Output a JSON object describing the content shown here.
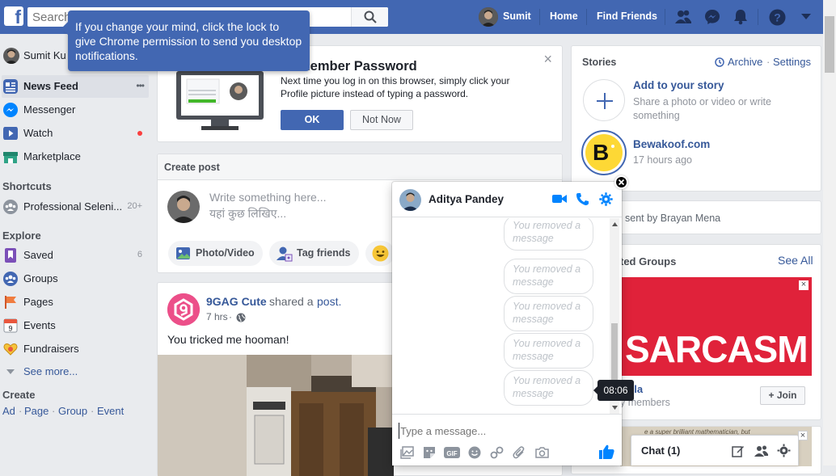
{
  "header": {
    "logo": "f",
    "search_placeholder": "Search",
    "user_name": "Sumit",
    "home_label": "Home",
    "find_friends_label": "Find Friends",
    "brand_color": "#4267b2"
  },
  "notification_tip": {
    "text": "If you change your mind, click the lock to give Chrome permission to send you desktop notifications."
  },
  "left_nav": {
    "profile_name": "Sumit Ku",
    "items": [
      {
        "label": "News Feed",
        "icon": "news-feed-icon",
        "more": "•••"
      },
      {
        "label": "Messenger",
        "icon": "messenger-icon"
      },
      {
        "label": "Watch",
        "icon": "watch-icon",
        "dot_color": "#fa3e3e"
      },
      {
        "label": "Marketplace",
        "icon": "marketplace-icon"
      }
    ],
    "shortcuts_title": "Shortcuts",
    "shortcuts": [
      {
        "label": "Professional Seleni...",
        "count": "20+",
        "icon": "group-icon"
      }
    ],
    "explore_title": "Explore",
    "explore": [
      {
        "label": "Saved",
        "count": "6",
        "icon": "saved-icon"
      },
      {
        "label": "Groups",
        "icon": "groups-icon"
      },
      {
        "label": "Pages",
        "icon": "pages-icon"
      },
      {
        "label": "Events",
        "icon": "events-icon"
      },
      {
        "label": "Fundraisers",
        "icon": "fundraisers-icon"
      }
    ],
    "see_more": "See more...",
    "create_title": "Create",
    "create_links": [
      "Ad",
      "Page",
      "Group",
      "Event"
    ]
  },
  "remember_password": {
    "title": "member Password",
    "body": "Next time you log in on this browser, simply click your Profile picture instead of typing a password.",
    "ok_label": "OK",
    "not_now_label": "Not Now",
    "close": "×"
  },
  "create_post": {
    "title": "Create post",
    "placeholder_en": "Write something here...",
    "placeholder_hi": "यहां कुछ लिखिए...",
    "actions": [
      {
        "label": "Photo/Video",
        "icon": "photo-video-icon"
      },
      {
        "label": "Tag friends",
        "icon": "tag-friends-icon"
      },
      {
        "label": "",
        "icon": "feeling-icon"
      }
    ]
  },
  "post": {
    "author": "9GAG Cute",
    "action_text": "shared a",
    "action_link": "post.",
    "time": "7 hrs",
    "separator": "·",
    "text": "You tricked me hooman!"
  },
  "stories": {
    "title": "Stories",
    "archive_label": "Archive",
    "settings_label": "Settings",
    "separator": "·",
    "add_title": "Add to your story",
    "add_sub": "Share a photo or video or write something",
    "story_name": "Bewakoof.com",
    "story_time": "17 hours ago",
    "story_logo": "B"
  },
  "invite": {
    "text": "sent by Brayan Mena"
  },
  "suggested": {
    "title": "ted Groups",
    "see_all": "See All",
    "banner_text": "SARCASM",
    "group_name": "rilla",
    "members": "y members",
    "join_label": "+ Join",
    "close": "×",
    "snippet": "e a super brilliant mathematician, but"
  },
  "chat_window": {
    "contact": "Aditya Pandey",
    "messages": [
      "You removed a message",
      "You removed a message",
      "You removed a message",
      "You removed a message",
      "You removed a message"
    ],
    "tooltip": "08:06",
    "input_placeholder": "Type a message...",
    "gif_label": "GIF"
  },
  "chat_bar": {
    "label": "Chat (1)"
  }
}
